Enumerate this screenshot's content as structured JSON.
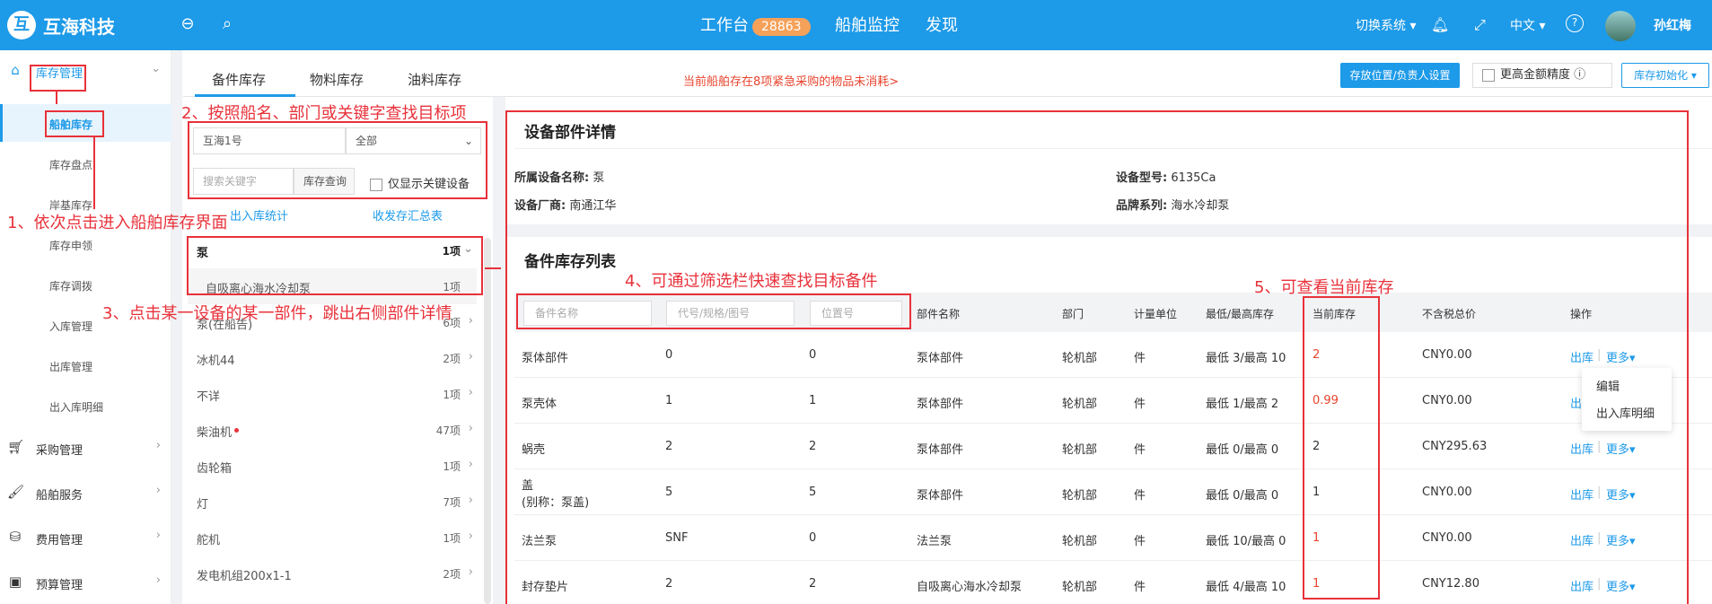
{
  "topbar": {
    "brand": "互海科技",
    "logo_glyph": "互",
    "nav_workbench": "工作台",
    "workbench_badge": "28863",
    "nav_monitor": "船舶监控",
    "nav_discover": "发现",
    "switch_system": "切换系统",
    "language": "中文",
    "username": "孙红梅"
  },
  "sidebar": {
    "inventory": "库存管理",
    "sub": [
      "船舶库存",
      "库存盘点",
      "岸基库存",
      "库存申领",
      "库存调拨",
      "入库管理",
      "出库管理",
      "出入库明细"
    ],
    "purchase": "采购管理",
    "ship_service": "船舶服务",
    "expense": "费用管理",
    "budget": "预算管理"
  },
  "tabs": [
    "备件库存",
    "物料库存",
    "油料库存"
  ],
  "warning": "当前船舶存在8项紧急采购的物品未消耗>",
  "buttons": {
    "location_setting": "存放位置/负责人设置",
    "precision": "更高金额精度",
    "init": "库存初始化"
  },
  "filters": {
    "ship": "互海1号",
    "dept": "全部",
    "keyword_placeholder": "搜索关键字",
    "search_btn": "库存查询",
    "only_key": "仅显示关键设备",
    "link_stats": "出入库统计",
    "link_summary": "收发存汇总表"
  },
  "devices": [
    {
      "name": "泵",
      "count": "1项"
    },
    {
      "name": "自吸离心海水冷却泵",
      "count": "1项"
    },
    {
      "name": "泵(在船告)",
      "count": "6项"
    },
    {
      "name": "冰机44",
      "count": "2项"
    },
    {
      "name": "不详",
      "count": "1项"
    },
    {
      "name": "柴油机",
      "count": "47项"
    },
    {
      "name": "齿轮箱",
      "count": "1项"
    },
    {
      "name": "灯",
      "count": "7项"
    },
    {
      "name": "舵机",
      "count": "1项"
    },
    {
      "name": "发电机组200x1-1",
      "count": "2项"
    }
  ],
  "detail": {
    "title": "设备部件详情",
    "device_name_label": "所属设备名称:",
    "device_name": "泵",
    "model_label": "设备型号:",
    "model": "6135Ca",
    "maker_label": "设备厂商:",
    "maker": "南通江华",
    "brand_label": "品牌系列:",
    "brand": "海水冷却泵"
  },
  "list": {
    "title": "备件库存列表",
    "filter_name": "备件名称",
    "filter_code": "代号/规格/图号",
    "filter_loc": "位置号",
    "headers": [
      "部件名称",
      "部门",
      "计量单位",
      "最低/最高库存",
      "当前库存",
      "不含税总价",
      "操作"
    ],
    "rows": [
      {
        "name": "泵体部件",
        "alias": "",
        "code": "0",
        "loc": "0",
        "part": "泵体部件",
        "dept": "轮机部",
        "unit": "件",
        "minmax": "最低 3/最高 10",
        "stock": "2",
        "red": true,
        "price": "CNY0.00"
      },
      {
        "name": "泵壳体",
        "alias": "",
        "code": "1",
        "loc": "1",
        "part": "泵体部件",
        "dept": "轮机部",
        "unit": "件",
        "minmax": "最低 1/最高 2",
        "stock": "0.99",
        "red": true,
        "price": "CNY0.00"
      },
      {
        "name": "蜗壳",
        "alias": "",
        "code": "2",
        "loc": "2",
        "part": "泵体部件",
        "dept": "轮机部",
        "unit": "件",
        "minmax": "最低 0/最高 0",
        "stock": "2",
        "red": false,
        "price": "CNY295.63"
      },
      {
        "name": "盖",
        "alias": "(别称：泵盖)",
        "code": "5",
        "loc": "5",
        "part": "泵体部件",
        "dept": "轮机部",
        "unit": "件",
        "minmax": "最低 0/最高 0",
        "stock": "1",
        "red": false,
        "price": "CNY0.00"
      },
      {
        "name": "法兰泵",
        "alias": "",
        "code": "SNF",
        "loc": "0",
        "part": "法兰泵",
        "dept": "轮机部",
        "unit": "件",
        "minmax": "最低 10/最高 0",
        "stock": "1",
        "red": true,
        "price": "CNY0.00"
      },
      {
        "name": "封存垫片",
        "alias": "",
        "code": "2",
        "loc": "2",
        "part": "自吸离心海水冷却泵",
        "dept": "轮机部",
        "unit": "件",
        "minmax": "最低 4/最高 10",
        "stock": "1",
        "red": true,
        "price": "CNY12.80"
      }
    ],
    "op_out": "出库",
    "op_more": "更多",
    "op_sep": "|",
    "dropdown": [
      "编辑",
      "出入库明细"
    ]
  },
  "annotations": {
    "a1": "1、依次点击进入船舶库存界面",
    "a2": "2、按照船名、部门或关键字查找目标项",
    "a3": "3、点击某一设备的某一部件，跳出右侧部件详情",
    "a4": "4、可通过筛选栏快速查找目标备件",
    "a5": "5、可查看当前库存"
  },
  "colors": {
    "primary": "#1d9ae8",
    "annotation": "#e8313a",
    "badge": "#f5a15a"
  }
}
